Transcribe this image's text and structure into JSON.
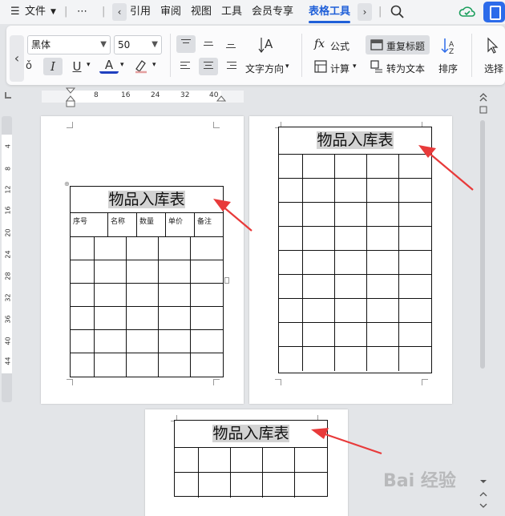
{
  "menu": {
    "file_icon": "hamburger-icon",
    "file": "文件",
    "more": "⋯",
    "items": [
      "引用",
      "审阅",
      "视图",
      "工具",
      "会员专享",
      "表格工具"
    ],
    "active": "表格工具"
  },
  "ribbon": {
    "font_name": "黑体",
    "font_size": "50",
    "italic": "I",
    "underline": "U",
    "font_color": "A",
    "text_direction": "文字方向",
    "formula": "公式",
    "repeat_header": "重复标题",
    "sort": "排序",
    "calculate": "计算",
    "convert_text": "转为文本",
    "select": "选择"
  },
  "ruler": {
    "h_ticks": [
      "8",
      "16",
      "24",
      "32",
      "40"
    ],
    "v_ticks": [
      "4",
      "8",
      "12",
      "16",
      "20",
      "24",
      "28",
      "32",
      "36",
      "40",
      "44"
    ]
  },
  "document": {
    "table_title": "物品入库表",
    "headers": [
      "序号",
      "名称",
      "数量",
      "单价",
      "备注"
    ]
  },
  "watermark": "Bai 经验",
  "colors": {
    "accent": "#1f5fd8",
    "arrow": "#e83a3a",
    "highlight": "#d3d3d3"
  }
}
